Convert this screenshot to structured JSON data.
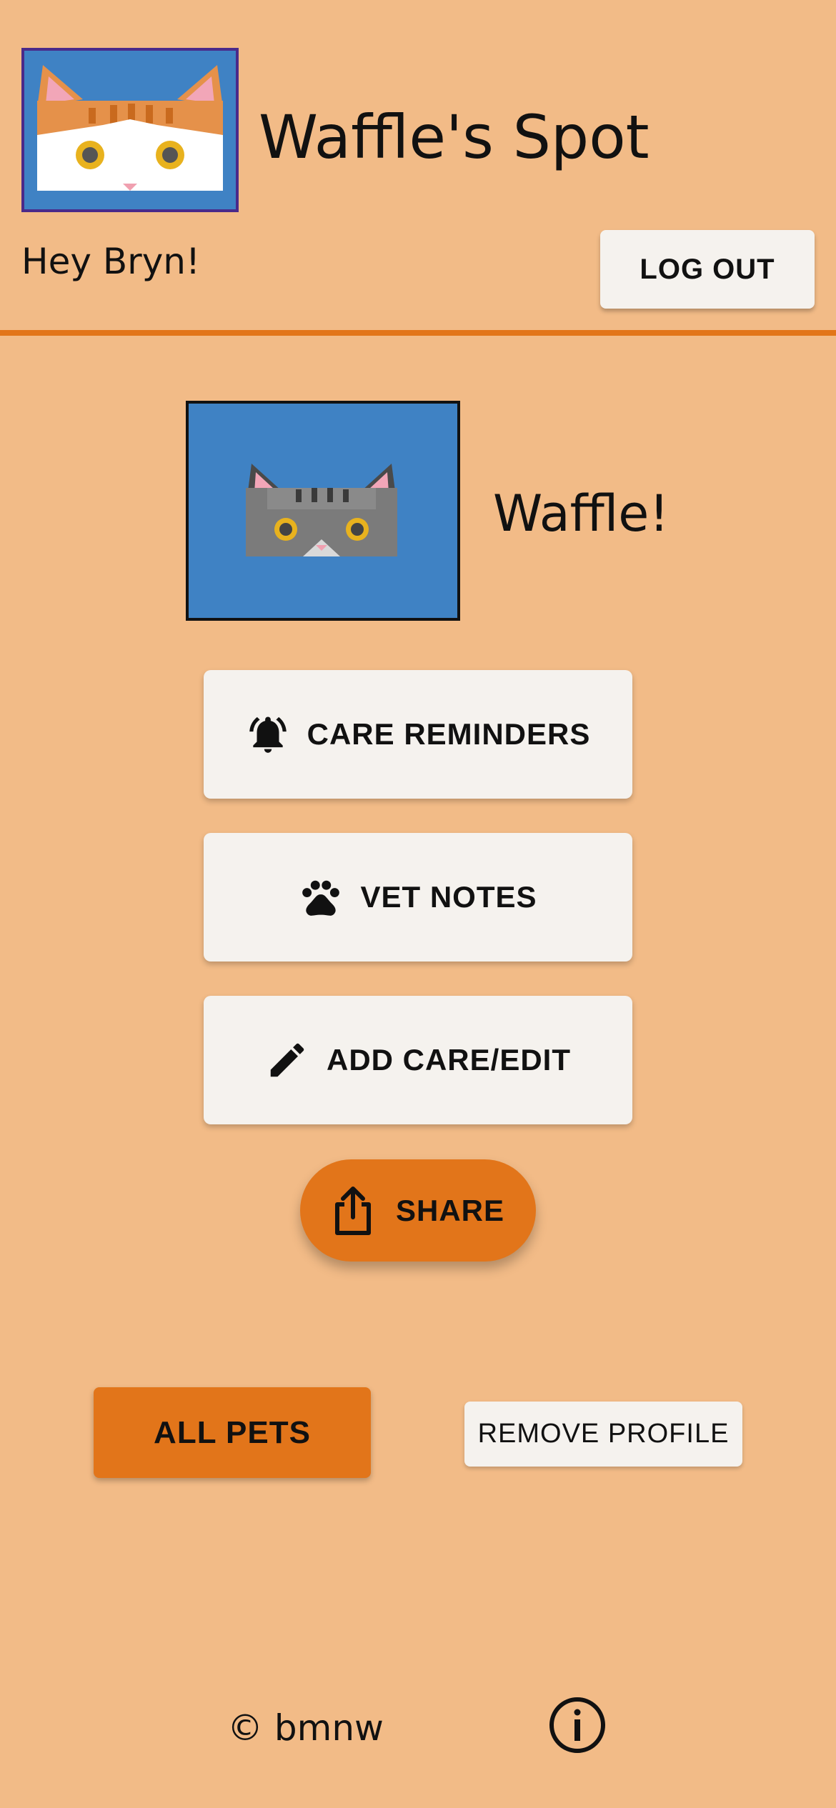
{
  "app": {
    "title": "Waffle's Spot"
  },
  "header": {
    "greeting": "Hey Bryn!",
    "logout_label": "LOG OUT",
    "logo_icon": "orange-white-cat-icon"
  },
  "pet": {
    "name": "Waffle!",
    "photo_icon": "gray-tabby-cat-icon"
  },
  "actions": {
    "care_reminders_label": "CARE REMINDERS",
    "care_reminders_icon": "bell-ringing-icon",
    "vet_notes_label": "VET NOTES",
    "vet_notes_icon": "paw-icon",
    "add_care_edit_label": "ADD CARE/EDIT",
    "add_care_edit_icon": "pencil-icon",
    "share_label": "SHARE",
    "share_icon": "share-icon"
  },
  "bottom": {
    "all_pets_label": "ALL PETS",
    "remove_profile_label": "REMOVE PROFILE"
  },
  "footer": {
    "copyright": "© bmnw",
    "info_icon": "info-icon"
  },
  "colors": {
    "background": "#f2bb87",
    "accent": "#e2751a",
    "button_light": "#f5f2ee",
    "photo_blue": "#3f82c4"
  }
}
